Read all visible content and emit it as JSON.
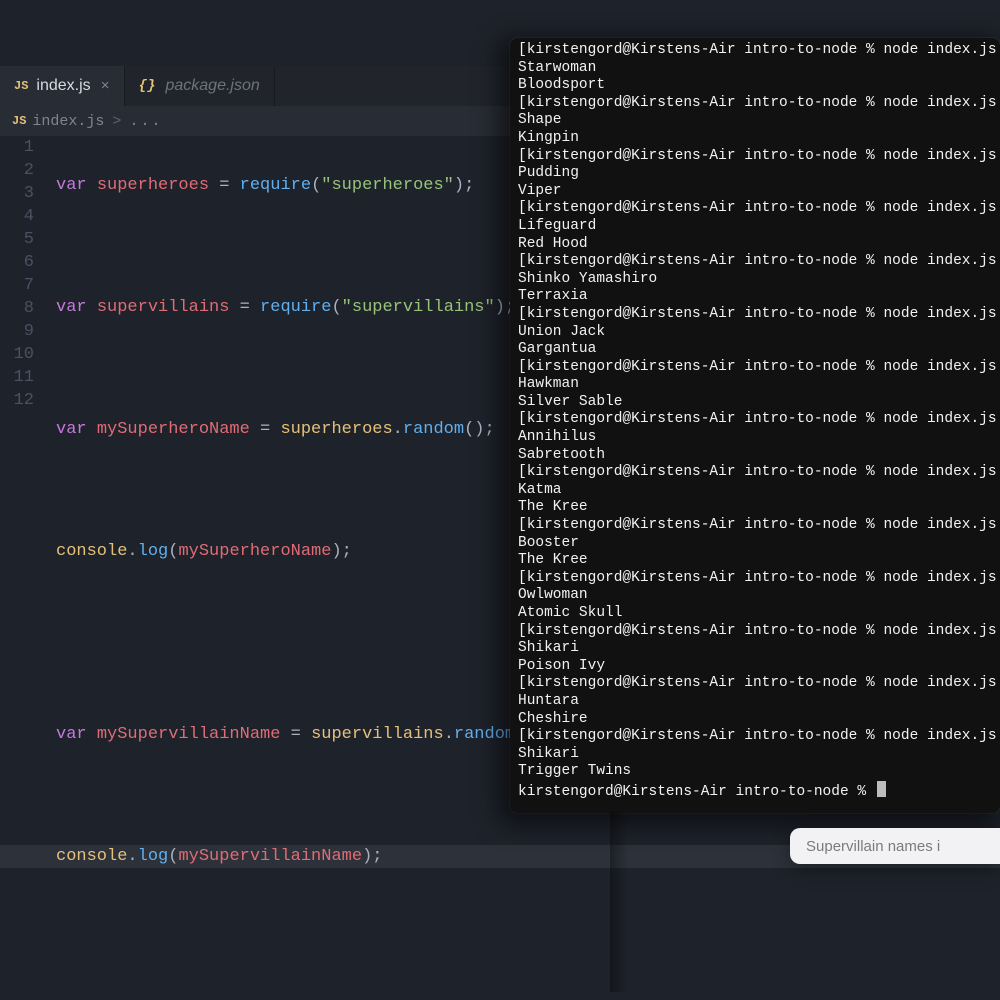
{
  "tabs": {
    "active": {
      "icon": "JS",
      "name": "index.js"
    },
    "inactive": {
      "icon": "{}",
      "name": "package.json"
    }
  },
  "breadcrumbs": {
    "icon": "JS",
    "file": "index.js",
    "chev": ">",
    "more": "..."
  },
  "editor": {
    "lineNumbers": [
      "1",
      "2",
      "3",
      "4",
      "5",
      "6",
      "7",
      "8",
      "9",
      "10",
      "11",
      "12"
    ],
    "tokens": {
      "var": "var",
      "superheroes": "superheroes",
      "supervillains": "supervillains",
      "mySuperheroName": "mySuperheroName",
      "mySupervillainName": "mySupervillainName",
      "eq": " = ",
      "require": "require",
      "open": "(",
      "close": ")",
      "semi": ";",
      "str_superheroes": "\"superheroes\"",
      "str_supervillains": "\"supervillains\"",
      "dot": ".",
      "random": "random",
      "console": "console",
      "log": "log"
    }
  },
  "terminal": {
    "prompt_prefix": "[",
    "prompt": "kirstengord@Kirstens-Air intro-to-node % node index.js",
    "last_prompt": "kirstengord@Kirstens-Air intro-to-node % ",
    "runs": [
      {
        "out": [
          "Starwoman",
          "Bloodsport"
        ]
      },
      {
        "out": [
          "Shape",
          "Kingpin"
        ]
      },
      {
        "out": [
          "Pudding",
          "Viper"
        ]
      },
      {
        "out": [
          "Lifeguard",
          "Red Hood"
        ]
      },
      {
        "out": [
          "Shinko Yamashiro",
          "Terraxia"
        ]
      },
      {
        "out": [
          "Union Jack",
          "Gargantua"
        ]
      },
      {
        "out": [
          "Hawkman",
          "Silver Sable"
        ]
      },
      {
        "out": [
          "Annihilus",
          "Sabretooth"
        ]
      },
      {
        "out": [
          "Katma",
          "The Kree"
        ]
      },
      {
        "out": [
          "Booster",
          "The Kree"
        ]
      },
      {
        "out": [
          "Owlwoman",
          "Atomic Skull"
        ]
      },
      {
        "out": [
          "Shikari",
          "Poison Ivy"
        ]
      },
      {
        "out": [
          "Huntara",
          "Cheshire"
        ]
      },
      {
        "out": [
          "Shikari",
          "Trigger Twins"
        ]
      }
    ]
  },
  "tooltip": "Supervillain names i"
}
